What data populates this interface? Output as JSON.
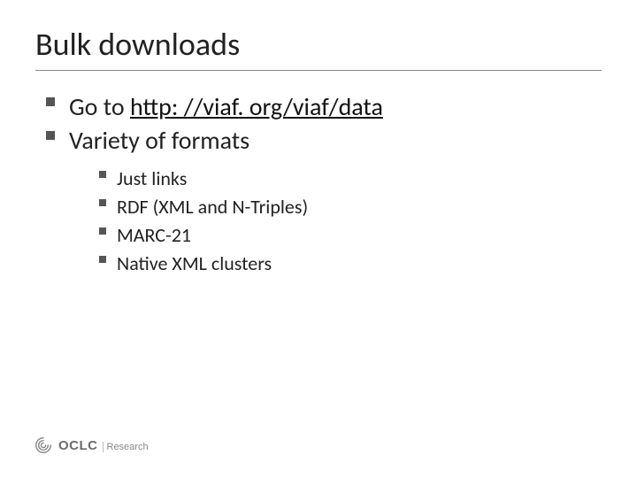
{
  "title": "Bulk downloads",
  "bullets": {
    "main": [
      {
        "prefix": "Go to ",
        "link": "http: //viaf. org/viaf/data"
      },
      {
        "text": "Variety of formats"
      }
    ],
    "sub": [
      "Just links",
      "RDF (XML and N-Triples)",
      "MARC-21",
      "Native XML clusters"
    ]
  },
  "footer": {
    "org": "OCLC",
    "unit": "Research"
  }
}
